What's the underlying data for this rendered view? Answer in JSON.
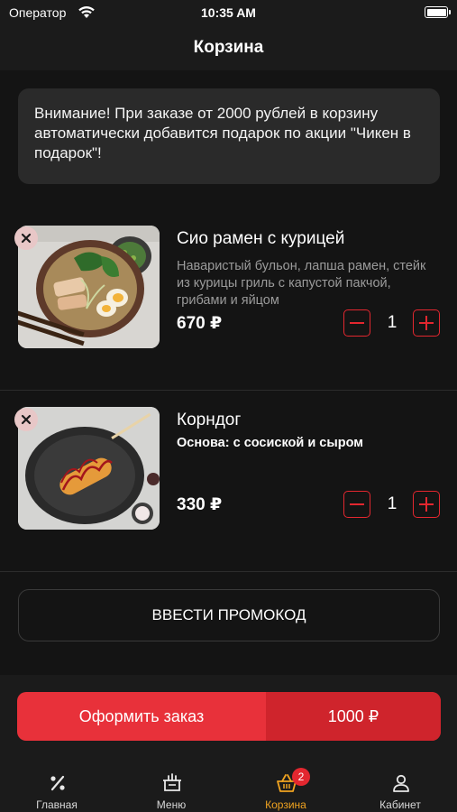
{
  "status_bar": {
    "carrier": "Оператор",
    "time": "10:35 AM"
  },
  "header": {
    "title": "Корзина"
  },
  "notice": {
    "text": "Внимание! При заказе от 2000 рублей в корзину автоматически добавится подарок по акции \"Чикен в подарок\"!"
  },
  "cart": {
    "items": [
      {
        "name": "Сио рамен с курицей",
        "description": "Наваристый бульон, лапша рамен, стейк из курицы гриль с капустой пакчой, грибами и яйцом",
        "price": "670 ₽",
        "quantity": "1",
        "image_icon": "ramen-bowl-image"
      },
      {
        "name": "Корндог",
        "option": "Основа: с сосиской и сыром",
        "price": "330 ₽",
        "quantity": "1",
        "image_icon": "corndog-plate-image"
      }
    ]
  },
  "promo": {
    "label": "ВВЕСТИ ПРОМОКОД"
  },
  "checkout": {
    "label": "Оформить заказ",
    "total": "1000 ₽"
  },
  "tabbar": {
    "tabs": [
      {
        "label": "Главная",
        "icon": "percent-icon",
        "active": false
      },
      {
        "label": "Меню",
        "icon": "menu-icon",
        "active": false
      },
      {
        "label": "Корзина",
        "icon": "basket-icon",
        "active": true,
        "badge": "2"
      },
      {
        "label": "Кабинет",
        "icon": "profile-icon",
        "active": false
      }
    ]
  },
  "colors": {
    "accent": "#e3272f",
    "active_tab": "#f0a320",
    "background": "#141414"
  }
}
